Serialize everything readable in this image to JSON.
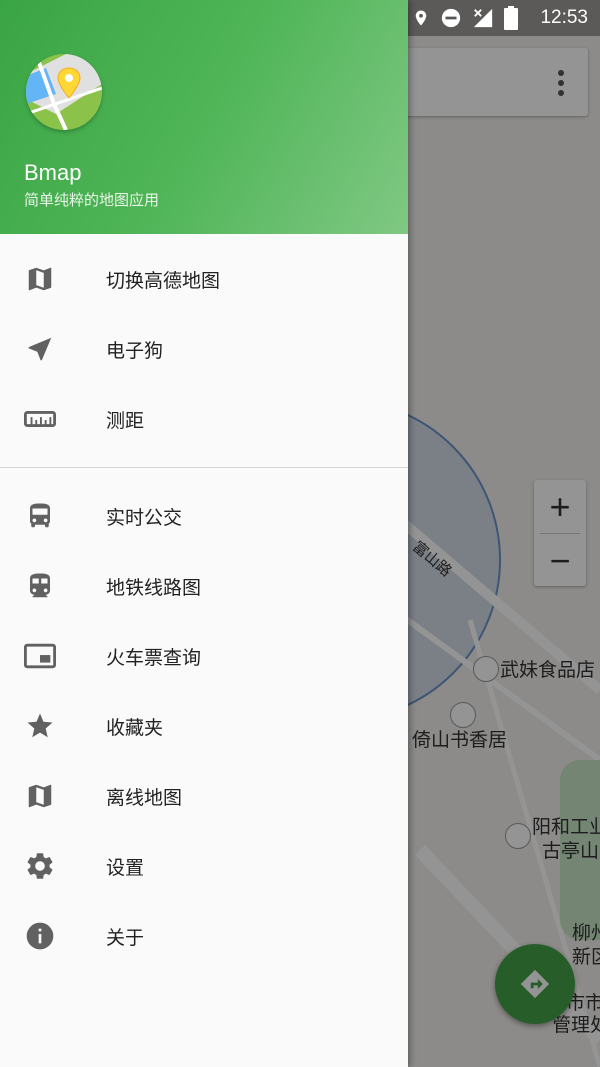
{
  "status_bar": {
    "time": "12:53",
    "icons": [
      "location-icon",
      "dnd-icon",
      "signal-icon",
      "battery-icon"
    ]
  },
  "drawer": {
    "app_name": "Bmap",
    "app_description": "简单纯粹的地图应用",
    "section1": [
      {
        "icon": "map-icon",
        "label": "切换高德地图"
      },
      {
        "icon": "navigation-arrow-icon",
        "label": "电子狗"
      },
      {
        "icon": "ruler-icon",
        "label": "测距"
      }
    ],
    "section2": [
      {
        "icon": "bus-icon",
        "label": "实时公交"
      },
      {
        "icon": "subway-icon",
        "label": "地铁线路图"
      },
      {
        "icon": "picture-in-picture-icon",
        "label": "火车票查询"
      },
      {
        "icon": "star-icon",
        "label": "收藏夹"
      },
      {
        "icon": "map-icon",
        "label": "离线地图"
      },
      {
        "icon": "gear-icon",
        "label": "设置"
      },
      {
        "icon": "info-icon",
        "label": "关于"
      }
    ]
  },
  "map": {
    "zoom_in": "+",
    "zoom_out": "−",
    "pois": [
      {
        "label": "武妹食品店"
      },
      {
        "label": "倚山书香居"
      },
      {
        "label": "阳和工业"
      },
      {
        "label": "古亭山"
      },
      {
        "label": "柳州"
      },
      {
        "label": "新区"
      },
      {
        "label": "市市"
      },
      {
        "label": "管理处"
      },
      {
        "label": "富山路"
      }
    ]
  },
  "colors": {
    "brand_green": "#4caf50",
    "fab_green": "#43a047",
    "icon_gray": "#616161"
  }
}
